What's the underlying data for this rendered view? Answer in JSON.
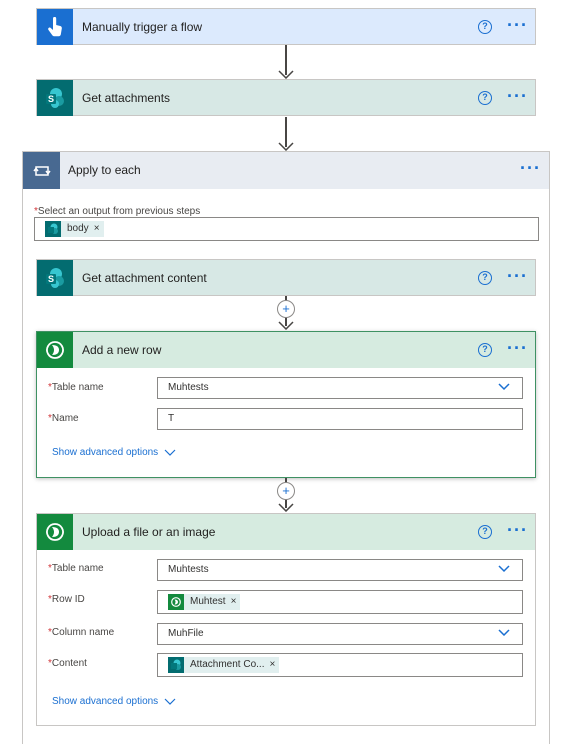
{
  "colors": {
    "trigger_bg": "#dceafd",
    "sharepoint_bg": "#d7e8e5",
    "dataverse_bg": "#d6ebe0",
    "loop_bg": "#e8ecf2",
    "loop_icon_bg": "#486991",
    "link": "#1a6fd1"
  },
  "steps": {
    "trigger": {
      "title": "Manually trigger a flow",
      "icon": "hand-touch-icon"
    },
    "get_attachments": {
      "title": "Get attachments",
      "icon": "sharepoint-icon"
    },
    "apply_to_each": {
      "title": "Apply to each",
      "icon": "loop-icon",
      "output_label": "Select an output from previous steps",
      "output_token": "body"
    },
    "get_attachment_content": {
      "title": "Get attachment content",
      "icon": "sharepoint-icon"
    },
    "add_row": {
      "title": "Add a new row",
      "icon": "dataverse-icon",
      "table_label": "Table name",
      "table_value": "Muhtests",
      "name_label": "Name",
      "name_value": "T",
      "advanced": "Show advanced options"
    },
    "upload_file": {
      "title": "Upload a file or an image",
      "icon": "dataverse-icon",
      "table_label": "Table name",
      "table_value": "Muhtests",
      "rowid_label": "Row ID",
      "rowid_token": "Muhtest",
      "column_label": "Column name",
      "column_value": "MuhFile",
      "content_label": "Content",
      "content_token": "Attachment Co...",
      "advanced": "Show advanced options"
    }
  },
  "common": {
    "required_mark": "*",
    "help_glyph": "?",
    "more_glyph": "···",
    "remove_glyph": "×",
    "add_glyph": "+"
  }
}
